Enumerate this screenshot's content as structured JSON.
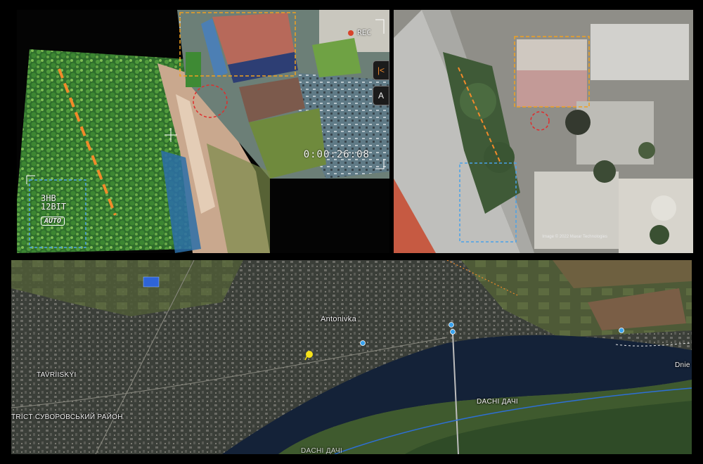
{
  "drone_feed": {
    "rec_label": "REC",
    "timer": "0:00:26:08",
    "bit_depth_line1": "3HB",
    "bit_depth_line2": "12BIT",
    "auto_label": "AUTO",
    "side_button_top": "|<",
    "side_button_bottom": "A"
  },
  "satellite": {
    "credit": "Image © 2022 Maxar Technologies"
  },
  "map": {
    "labels": {
      "antonivka": "Antonivka",
      "tavriiskyi": "TAVRIISKYI",
      "district": "TRICT СУВОРОВСЬКИЙ РАЙОН",
      "dachi": "DACHI ДАЧІ",
      "river": "Dnie",
      "dachi_bottom": "DACHI ДАЧІ"
    },
    "colors": {
      "river": "#142238",
      "pin": "#f5e11a",
      "marker": "#2e64d8",
      "point": "#3aa3ee"
    }
  },
  "colors": {
    "orange_marker": "#f28a2a",
    "red_marker": "#e02c2c",
    "blue_marker": "#4aa2e8"
  }
}
